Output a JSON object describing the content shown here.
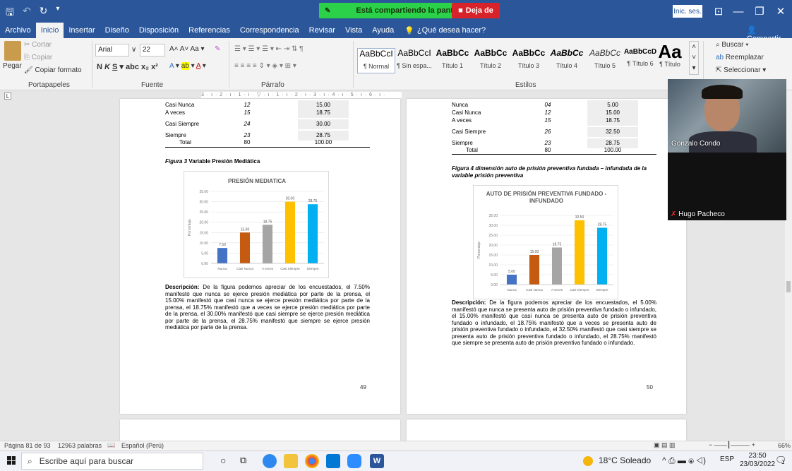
{
  "titlebar": {
    "sharing_text": "Está compartiendo la pantalla",
    "stop_label": "Deja de",
    "signin_label": "Inic. ses."
  },
  "tabs": [
    "Archivo",
    "Inicio",
    "Insertar",
    "Diseño",
    "Disposición",
    "Referencias",
    "Correspondencia",
    "Revisar",
    "Vista",
    "Ayuda"
  ],
  "tab_help": "¿Qué desea hacer?",
  "share_label": "Compartir",
  "ribbon": {
    "clipboard": {
      "paste": "Pegar",
      "cut": "Cortar",
      "copy": "Copiar",
      "format_painter": "Copiar formato",
      "label": "Portapapeles"
    },
    "font": {
      "name": "Arial",
      "size": "22",
      "label": "Fuente"
    },
    "paragraph_label": "Párrafo",
    "styles_label": "Estilos",
    "styles": [
      {
        "preview": "AaBbCcI",
        "name": "¶ Normal"
      },
      {
        "preview": "AaBbCcI",
        "name": "¶ Sin espa..."
      },
      {
        "preview": "AaBbCc",
        "name": "Título 1"
      },
      {
        "preview": "AaBbCc",
        "name": "Título 2"
      },
      {
        "preview": "AaBbCc",
        "name": "Título 3"
      },
      {
        "preview": "AaBbCc",
        "name": "Título 4"
      },
      {
        "preview": "AaBbCc",
        "name": "Título 5"
      },
      {
        "preview": "AaBbCcD",
        "name": "¶ Título 6"
      },
      {
        "preview": "Aa",
        "name": "¶ Título"
      }
    ],
    "editing": {
      "find": "Buscar",
      "replace": "Reemplazar",
      "select": "Seleccionar"
    }
  },
  "ruler_text": "3 · ı · 2 · ı · 1 · ı · ▽ · ı · 1 · ı · 2 · ı · 3 · ı · 4 · ı · 5 · ı · 6 · ı ·",
  "page_left": {
    "table_rows": [
      {
        "label": "Casi Nunca",
        "freq": "12",
        "pct": "15.00"
      },
      {
        "label": "A veces",
        "freq": "15",
        "pct": "18.75"
      },
      {
        "label": "Casi Siempre",
        "freq": "24",
        "pct": "30.00"
      },
      {
        "label": "Siempre",
        "freq": "23",
        "pct": "28.75"
      },
      {
        "label": "Total",
        "freq": "80",
        "pct": "100.00"
      }
    ],
    "figure_caption_prefix": "Figura 3",
    "figure_caption": " Variable Presión Mediática",
    "description_label": "Descripción:",
    "description": " De la figura podemos apreciar de los encuestados, el 7.50% manifestó que nunca se ejerce presión mediática por parte de la prensa, el 15.00% manifestó que casi nunca se ejerce presión mediática por parte de la prensa, el 18.75% manifestó que a veces se ejerce presión mediática por parte de la prensa, el 30.00% manifestó que casi siempre se ejerce presión mediática por parte de la prensa, el 28.75% manifestó que siempre se ejerce presión mediática por parte de la prensa.",
    "page_number": "49"
  },
  "page_right": {
    "table_rows": [
      {
        "label": "Nunca",
        "freq": "04",
        "pct": "5.00"
      },
      {
        "label": "Casi Nunca",
        "freq": "12",
        "pct": "15.00"
      },
      {
        "label": "A veces",
        "freq": "15",
        "pct": "18.75"
      },
      {
        "label": "Casi Siempre",
        "freq": "26",
        "pct": "32.50"
      },
      {
        "label": "Siempre",
        "freq": "23",
        "pct": "28.75"
      },
      {
        "label": "Total",
        "freq": "80",
        "pct": "100.00"
      }
    ],
    "figure_caption": "Figura 4 dimensión auto de prisión preventiva fundada – infundada de la variable prisión preventiva",
    "description_label": "Descripción:",
    "description": " De la figura podemos apreciar de los encuestados, el 5.00% manifestó que nunca se presenta auto de prisión preventiva fundado o infundado, el 15.00% manifestó que casi nunca se presenta auto de prisión preventiva fundado o infundado, el 18.75% manifestó que a veces se presenta auto de prisión preventiva fundado o infundado, el 32.50% manifestó que casi siempre se presenta auto de prisión preventiva fundado o infundado, el 28.75% manifestó que siempre se presenta auto de prisión preventiva fundado o infundado.",
    "page_number": "50"
  },
  "chart_data": [
    {
      "type": "bar",
      "title": "PRESIÓN MEDIATICA",
      "ylabel": "Porcentaje",
      "categories": [
        "Nunca",
        "Casi Nunca",
        "A veces",
        "Casi Siempre",
        "Siempre"
      ],
      "values": [
        7.5,
        15.0,
        18.75,
        30.0,
        28.75
      ],
      "value_labels": [
        "7.50",
        "15.00",
        "18.75",
        "30.00",
        "28.75"
      ],
      "colors": [
        "#4472c4",
        "#c55a11",
        "#a5a5a5",
        "#ffc000",
        "#00b0f0"
      ],
      "yticks": [
        "0.00",
        "5.00",
        "10.00",
        "15.00",
        "20.00",
        "25.00",
        "30.00",
        "35.00"
      ],
      "ylim": [
        0,
        35
      ]
    },
    {
      "type": "bar",
      "title": "AUTO DE PRISIÓN PREVENTIVA FUNDADO - INFUNDADO",
      "ylabel": "Porcentaje",
      "categories": [
        "Nunca",
        "Casi Nunca",
        "A veces",
        "Casi Siempre",
        "Siempre"
      ],
      "values": [
        5.0,
        15.0,
        18.75,
        32.5,
        28.75
      ],
      "value_labels": [
        "5.00",
        "15.00",
        "18.75",
        "32.50",
        "28.75"
      ],
      "colors": [
        "#4472c4",
        "#c55a11",
        "#a5a5a5",
        "#ffc000",
        "#00b0f0"
      ],
      "yticks": [
        "0.00",
        "5.00",
        "10.00",
        "15.00",
        "20.00",
        "25.00",
        "30.00",
        "35.00"
      ],
      "ylim": [
        0,
        35
      ]
    }
  ],
  "video": {
    "person1": "Gonzalo Condo",
    "person2": "Hugo Pacheco"
  },
  "statusbar": {
    "page": "Página 81 de 93",
    "words": "12963 palabras",
    "lang": "Español (Perú)",
    "zoom": "66%"
  },
  "taskbar": {
    "search_placeholder": "Escribe aquí para buscar",
    "weather": "18°C Soleado",
    "lang": "ESP",
    "time": "23:50",
    "date": "23/03/2022",
    "notif_count": "1"
  }
}
